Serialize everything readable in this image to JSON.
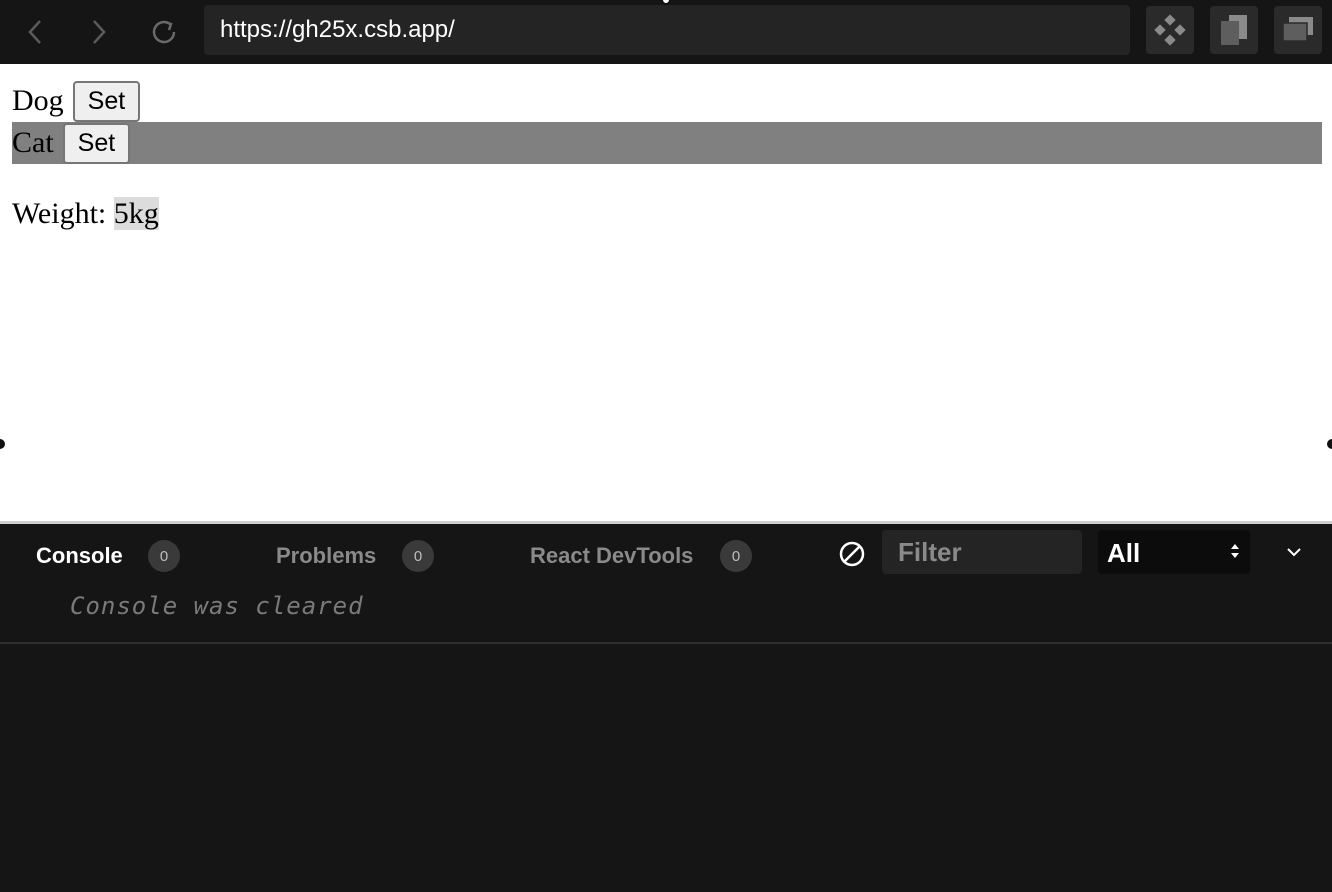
{
  "browser": {
    "url": "https://gh25x.csb.app/",
    "icons": {
      "back": "chevron-left-icon",
      "forward": "chevron-right-icon",
      "refresh": "refresh-icon",
      "devtools": "diamond-grid-icon",
      "new_window": "copy-window-icon",
      "open_external": "stacked-windows-icon"
    }
  },
  "preview": {
    "animals": [
      {
        "name": "Dog",
        "button": "Set",
        "selected": false
      },
      {
        "name": "Cat",
        "button": "Set",
        "selected": true
      }
    ],
    "weight_label": "Weight: ",
    "weight_value": "5kg",
    "colors": {
      "selected_row": "#808080",
      "highlight": "#dcdcdc"
    }
  },
  "devtools": {
    "tabs": [
      {
        "label": "Console",
        "count": "0",
        "active": true
      },
      {
        "label": "Problems",
        "count": "0",
        "active": false
      },
      {
        "label": "React DevTools",
        "count": "0",
        "active": false
      }
    ],
    "filter_placeholder": "Filter",
    "level_value": "All",
    "console_message": "Console was cleared"
  }
}
